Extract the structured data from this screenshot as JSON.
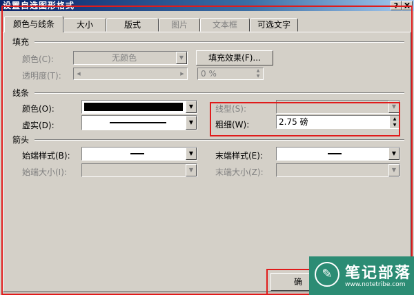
{
  "window": {
    "title": "设置自选图形格式",
    "help_label": "?",
    "close_label": "X"
  },
  "tabs": [
    {
      "label": "颜色与线条",
      "state": "active"
    },
    {
      "label": "大小",
      "state": "normal"
    },
    {
      "label": "版式",
      "state": "normal"
    },
    {
      "label": "图片",
      "state": "disabled"
    },
    {
      "label": "文本框",
      "state": "disabled"
    },
    {
      "label": "可选文字",
      "state": "normal"
    }
  ],
  "fill": {
    "group_label": "填充",
    "color_label": "颜色(C):",
    "color_value": "无颜色",
    "effects_button": "填充效果(F)...",
    "transparency_label": "透明度(T):",
    "transparency_value": "0 %"
  },
  "line": {
    "group_label": "线条",
    "color_label": "颜色(O):",
    "color_value": "#000000",
    "dash_label": "虚实(D):",
    "style_label": "线型(S):",
    "weight_label": "粗细(W):",
    "weight_value": "2.75 磅"
  },
  "arrows": {
    "group_label": "箭头",
    "begin_style_label": "始端样式(B):",
    "end_style_label": "末端样式(E):",
    "begin_size_label": "始端大小(I):",
    "end_size_label": "末端大小(Z):"
  },
  "footer": {
    "ok_label": "确"
  },
  "watermark": {
    "title": "笔记部落",
    "url": "www.notetribe.com"
  },
  "colors": {
    "highlight": "#e01b1b",
    "dialog": "#d4d0c8",
    "watermark": "#2c8c74"
  }
}
